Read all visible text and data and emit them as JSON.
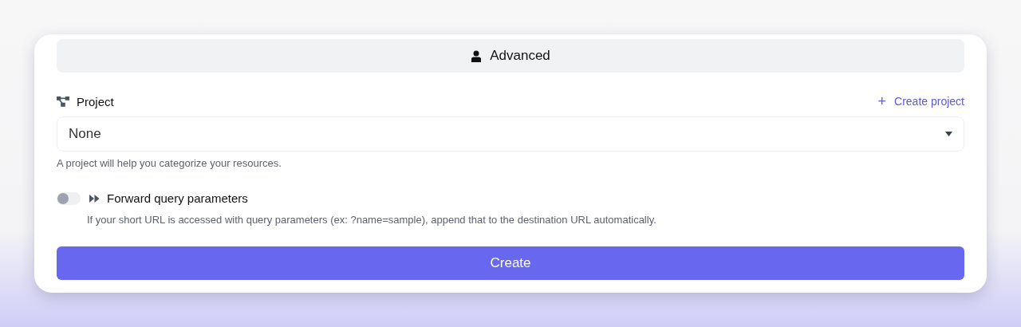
{
  "advanced_button": {
    "label": "Advanced"
  },
  "project": {
    "label": "Project",
    "create_link": {
      "icon": "+",
      "label": "Create project"
    },
    "select": {
      "value": "None"
    },
    "hint": "A project will help you categorize your resources."
  },
  "forward_query": {
    "on": false,
    "label": "Forward query parameters",
    "hint": "If your short URL is accessed with query parameters (ex: ?name=sample), append that to the destination URL automatically."
  },
  "create_button": {
    "label": "Create"
  }
}
